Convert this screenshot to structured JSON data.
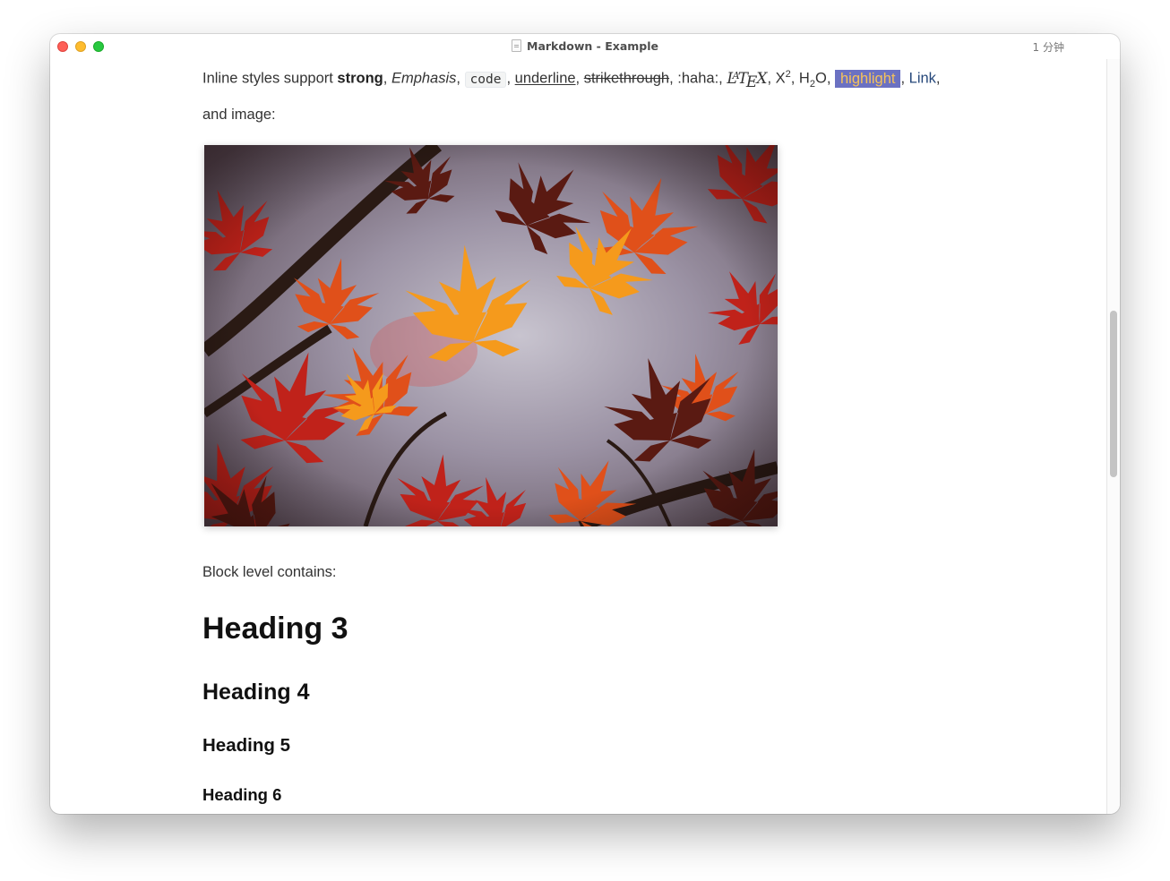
{
  "window": {
    "title": "Markdown - Example",
    "word_count": "1 分钟",
    "traffic_lights": {
      "close": "#fe5f57",
      "minimize": "#febc2e",
      "zoom": "#28c840"
    }
  },
  "inline": {
    "prefix": "Inline styles support ",
    "strong": "strong",
    "sep1": ", ",
    "emphasis": "Emphasis",
    "sep2": ", ",
    "code": "code",
    "sep3": ", ",
    "underline": "underline",
    "sep4": ", ",
    "strikethrough": "strikethrough",
    "sep5": ", :haha:, ",
    "latex_l": "L",
    "latex_a": "A",
    "latex_t": "T",
    "latex_e": "E",
    "latex_x": "X",
    "sep6": ", X",
    "superscript": "2",
    "sep7": ", H",
    "subscript": "2",
    "sep8": "O, ",
    "highlight": "highlight",
    "sep9": ", ",
    "link": "Link",
    "sep10": ",",
    "suffix": "and image:"
  },
  "image": {
    "subject": "autumn red maple leaves",
    "accent": "#f08a1c"
  },
  "block": {
    "label": "Block level contains:",
    "heading3": "Heading 3",
    "heading4": "Heading 4",
    "heading5": "Heading 5",
    "heading6": "Heading 6"
  },
  "colors": {
    "highlight_bg": "#6b71c2",
    "highlight_text": "#f5c25a",
    "link": "#25477a"
  }
}
